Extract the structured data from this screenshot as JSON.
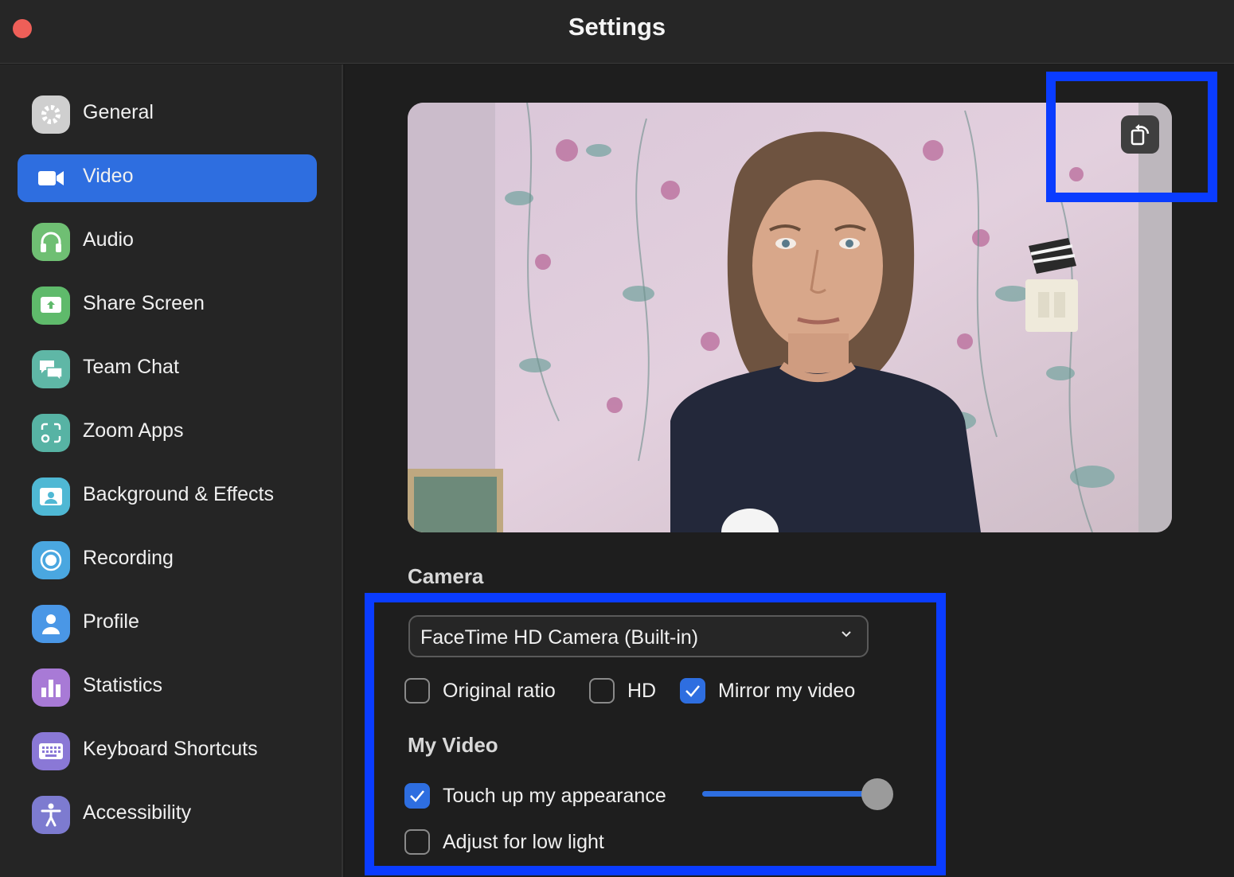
{
  "window": {
    "title": "Settings"
  },
  "sidebar": {
    "items": [
      {
        "label": "General",
        "icon": "gear-icon",
        "color": "#cfcfcf",
        "active": false
      },
      {
        "label": "Video",
        "icon": "video-camera-icon",
        "color": "#2e6ee0",
        "active": true
      },
      {
        "label": "Audio",
        "icon": "headphones-icon",
        "color": "#6fbf73",
        "active": false
      },
      {
        "label": "Share Screen",
        "icon": "share-screen-icon",
        "color": "#5fba6b",
        "active": false
      },
      {
        "label": "Team Chat",
        "icon": "chat-bubbles-icon",
        "color": "#5fb7a6",
        "active": false
      },
      {
        "label": "Zoom Apps",
        "icon": "apps-icon",
        "color": "#57b3a4",
        "active": false
      },
      {
        "label": "Background & Effects",
        "icon": "background-person-icon",
        "color": "#4fb8d4",
        "active": false
      },
      {
        "label": "Recording",
        "icon": "record-icon",
        "color": "#4aa7e0",
        "active": false
      },
      {
        "label": "Profile",
        "icon": "user-icon",
        "color": "#4a97e6",
        "active": false
      },
      {
        "label": "Statistics",
        "icon": "bar-chart-icon",
        "color": "#a87ad6",
        "active": false
      },
      {
        "label": "Keyboard Shortcuts",
        "icon": "keyboard-icon",
        "color": "#8a78d6",
        "active": false
      },
      {
        "label": "Accessibility",
        "icon": "accessibility-icon",
        "color": "#7d7bd0",
        "active": false
      }
    ]
  },
  "camera": {
    "section_title": "Camera",
    "selected_device": "FaceTime HD Camera (Built-in)",
    "options": [
      {
        "label": "Original ratio",
        "checked": false
      },
      {
        "label": "HD",
        "checked": false
      },
      {
        "label": "Mirror my video",
        "checked": true
      }
    ]
  },
  "my_video": {
    "section_title": "My Video",
    "touch_up": {
      "label": "Touch up my appearance",
      "checked": true,
      "level_percent": 100
    },
    "low_light": {
      "label": "Adjust for low light",
      "checked": false
    }
  },
  "colors": {
    "accent": "#2e6ee0",
    "highlight": "#0a3cff"
  }
}
